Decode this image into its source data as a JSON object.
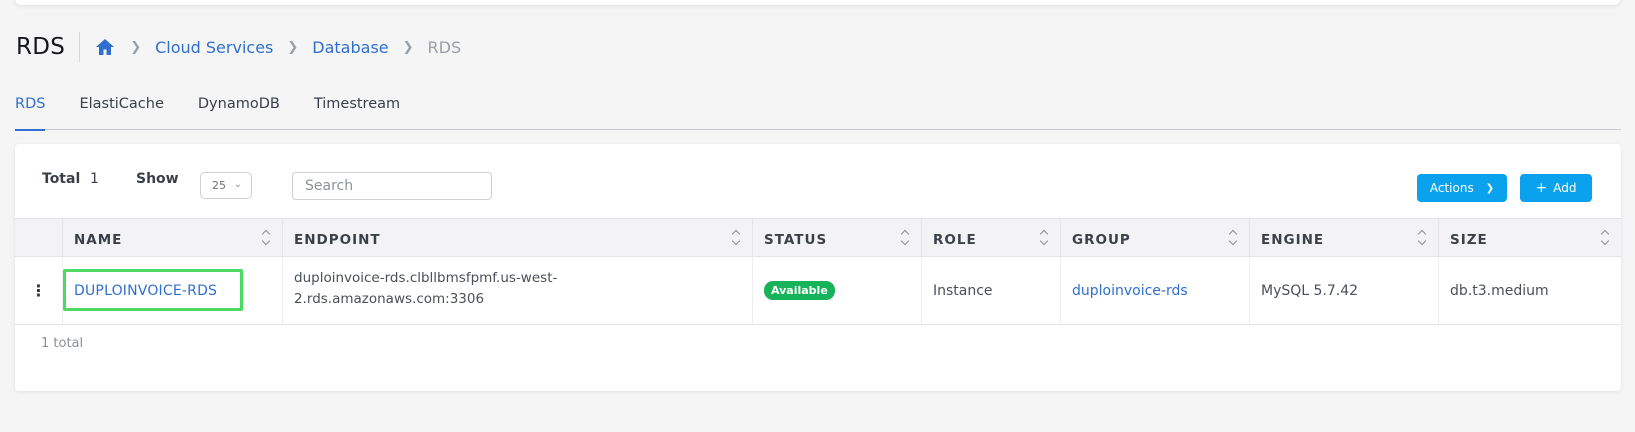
{
  "header": {
    "title": "RDS",
    "breadcrumbs": [
      "Cloud Services",
      "Database"
    ],
    "breadcrumb_current": "RDS"
  },
  "tabs": [
    {
      "label": "RDS",
      "active": true
    },
    {
      "label": "ElastiCache",
      "active": false
    },
    {
      "label": "DynamoDB",
      "active": false
    },
    {
      "label": "Timestream",
      "active": false
    }
  ],
  "toolbar": {
    "total_label": "Total",
    "total_value": "1",
    "show_label": "Show",
    "page_size": "25",
    "search_placeholder": "Search",
    "actions_label": "Actions",
    "add_label": "Add"
  },
  "table": {
    "columns": [
      "NAME",
      "ENDPOINT",
      "STATUS",
      "ROLE",
      "GROUP",
      "ENGINE",
      "SIZE"
    ],
    "rows": [
      {
        "name": "DUPLOINVOICE-RDS",
        "endpoint_line1": "duploinvoice-rds.clbllbmsfpmf.us-west-",
        "endpoint_line2": "2.rds.amazonaws.com:3306",
        "status": "Available",
        "role": "Instance",
        "group": "duploinvoice-rds",
        "engine": "MySQL 5.7.42",
        "size": "db.t3.medium"
      }
    ]
  },
  "footer": {
    "total_text": "1 total"
  },
  "colors": {
    "accent": "#2f6fcf",
    "button": "#0aa2ec",
    "status_available": "#16b35a",
    "highlight": "#4cd964"
  },
  "icons": {
    "home": "home-icon",
    "breadcrumb_separator": "chevron-right-icon",
    "row_menu": "kebab-icon",
    "sort": "sort-icon"
  }
}
